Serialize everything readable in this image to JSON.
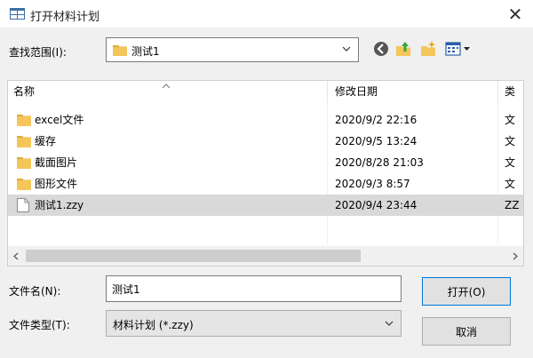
{
  "window": {
    "title": "打开材料计划"
  },
  "look_in": {
    "label": "查找范围(I):",
    "value": "测试1"
  },
  "toolbar": {
    "icons": [
      "back-icon",
      "up-folder-icon",
      "new-folder-icon",
      "view-menu-icon"
    ]
  },
  "list": {
    "columns": [
      {
        "label": "名称"
      },
      {
        "label": "修改日期"
      },
      {
        "label": "类"
      }
    ],
    "rows": [
      {
        "name": "excel文件",
        "date": "2020/9/2 22:16",
        "type": "文",
        "icon": "folder-icon"
      },
      {
        "name": "缓存",
        "date": "2020/9/5 13:24",
        "type": "文",
        "icon": "folder-icon"
      },
      {
        "name": "截面图片",
        "date": "2020/8/28 21:03",
        "type": "文",
        "icon": "folder-icon"
      },
      {
        "name": "图形文件",
        "date": "2020/9/3 8:57",
        "type": "文",
        "icon": "folder-icon"
      },
      {
        "name": "测试1.zzy",
        "date": "2020/9/4 23:44",
        "type": "ZZ",
        "icon": "file-icon",
        "selected": true
      }
    ]
  },
  "file_name": {
    "label": "文件名(N):",
    "value": "测试1"
  },
  "file_type": {
    "label": "文件类型(T):",
    "value": "材料计划 (*.zzy)"
  },
  "buttons": {
    "open": "打开(O)",
    "cancel": "取消"
  },
  "colors": {
    "folder": "#f4c65a",
    "folder_tab": "#e0a93a",
    "selected_row": "#d9d9d9",
    "focus_border": "#0078d7"
  }
}
